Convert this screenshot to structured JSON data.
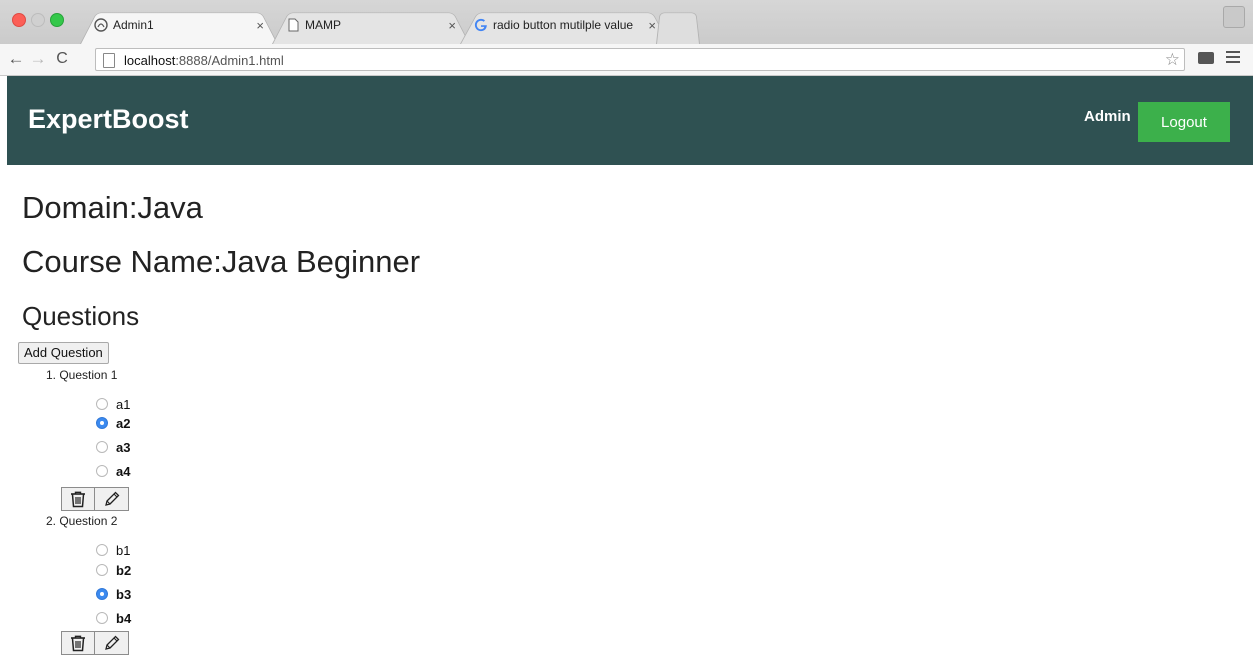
{
  "browser": {
    "tabs": [
      {
        "title": "Admin1",
        "close": "×",
        "favicon": "page-favicon",
        "active": true
      },
      {
        "title": "MAMP",
        "close": "×",
        "favicon": "document-favicon",
        "active": false
      },
      {
        "title": "radio button mutilple value",
        "close": "×",
        "favicon": "google-favicon",
        "active": false
      }
    ],
    "url_host": "localhost",
    "url_rest": ":8888/Admin1.html",
    "icons": [
      "back-icon",
      "forward-icon",
      "reload-icon",
      "star-icon",
      "cast-icon",
      "menu-icon"
    ]
  },
  "header": {
    "brand": "ExpertBoost",
    "admin_label": "Admin",
    "logout_label": "Logout",
    "bg_color": "#2f5152",
    "logout_color": "#3cb04b"
  },
  "main": {
    "domain_heading": "Domain:Java",
    "course_heading": "Course Name:Java Beginner",
    "questions_heading": "Questions",
    "add_question_label": "Add Question",
    "questions": [
      {
        "title": "1. Question 1",
        "options": [
          {
            "label": "a1",
            "checked": false,
            "bold": false
          },
          {
            "label": "a2",
            "checked": true,
            "bold": true
          },
          {
            "label": "a3",
            "checked": false,
            "bold": true
          },
          {
            "label": "a4",
            "checked": false,
            "bold": true
          }
        ],
        "actions": [
          "trash-icon",
          "pencil-icon"
        ]
      },
      {
        "title": "2. Question 2",
        "options": [
          {
            "label": "b1",
            "checked": false,
            "bold": false
          },
          {
            "label": "b2",
            "checked": false,
            "bold": true
          },
          {
            "label": "b3",
            "checked": true,
            "bold": true
          },
          {
            "label": "b4",
            "checked": false,
            "bold": true
          }
        ],
        "actions": [
          "trash-icon",
          "pencil-icon"
        ]
      }
    ]
  }
}
